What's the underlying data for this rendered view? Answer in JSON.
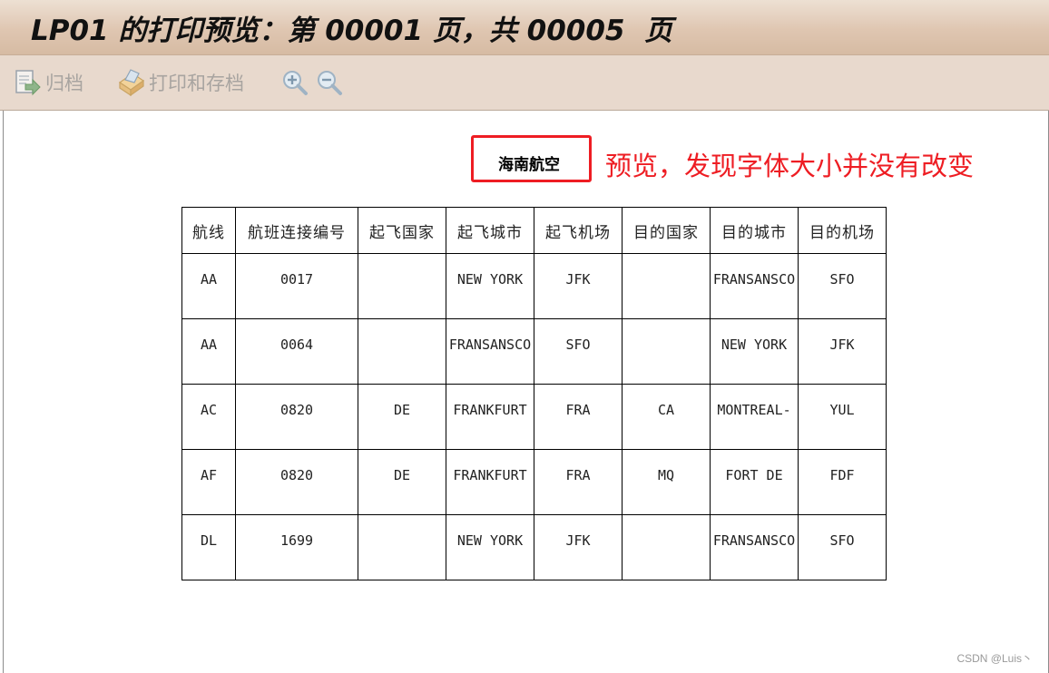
{
  "window": {
    "title": "LP01 的打印预览：第 00001 页，共 00005  页"
  },
  "toolbar": {
    "archive_label": "归档",
    "print_archive_label": "打印和存档",
    "icons": [
      "archive-icon",
      "print-icon",
      "zoom-in-icon",
      "zoom-out-icon"
    ]
  },
  "document": {
    "title": "海南航空"
  },
  "annotation": {
    "text": "预览，发现字体大小并没有改变",
    "color": "#ee1d23"
  },
  "table": {
    "headers": [
      "航线",
      "航班连接编号",
      "起飞国家",
      "起飞城市",
      "起飞机场",
      "目的国家",
      "目的城市",
      "目的机场"
    ],
    "rows": [
      [
        "AA",
        "0017",
        "",
        "NEW  YORK",
        "JFK",
        "",
        "FRANSANSCO",
        "SFO"
      ],
      [
        "AA",
        "0064",
        "",
        "FRANSANSCO",
        "SFO",
        "",
        "NEW  YORK",
        "JFK"
      ],
      [
        "AC",
        "0820",
        "DE",
        "FRANKFURT",
        "FRA",
        "CA",
        "MONTREAL-",
        "YUL"
      ],
      [
        "AF",
        "0820",
        "DE",
        "FRANKFURT",
        "FRA",
        "MQ",
        "FORT DE",
        "FDF"
      ],
      [
        "DL",
        "1699",
        "",
        "NEW  YORK",
        "JFK",
        "",
        "FRANSANSCO",
        "SFO"
      ]
    ]
  },
  "watermark": "CSDN @Luis丶"
}
